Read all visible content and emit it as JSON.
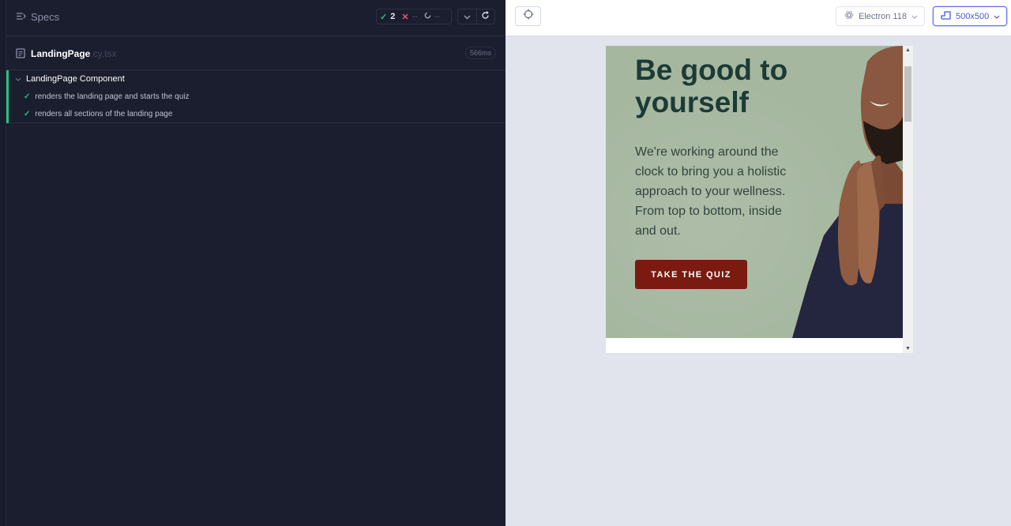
{
  "reporter": {
    "specs_label": "Specs",
    "stats": {
      "passed": "2",
      "failed": "--",
      "pending": "--"
    },
    "file": {
      "name": "LandingPage",
      "ext": ".cy.tsx",
      "duration": "566ms"
    },
    "suite": {
      "title": "LandingPage Component",
      "tests": [
        {
          "title": "renders the landing page and starts the quiz",
          "state": "passed"
        },
        {
          "title": "renders all sections of the landing page",
          "state": "passed"
        }
      ]
    }
  },
  "toolbar": {
    "browser": "Electron 118",
    "viewport": "500x500"
  },
  "aut": {
    "headline": "Be good to yourself",
    "body": "We're working around the clock to bring you a holistic approach to your wellness. From top to bottom, inside and out.",
    "cta": "TAKE THE QUIZ"
  },
  "colors": {
    "pass": "#27c07d",
    "fail": "#e45770",
    "hero_bg": "#a6b7a0",
    "headline": "#1d3b35",
    "cta_bg": "#7a1a10",
    "viewport_accent": "#4956e3"
  }
}
